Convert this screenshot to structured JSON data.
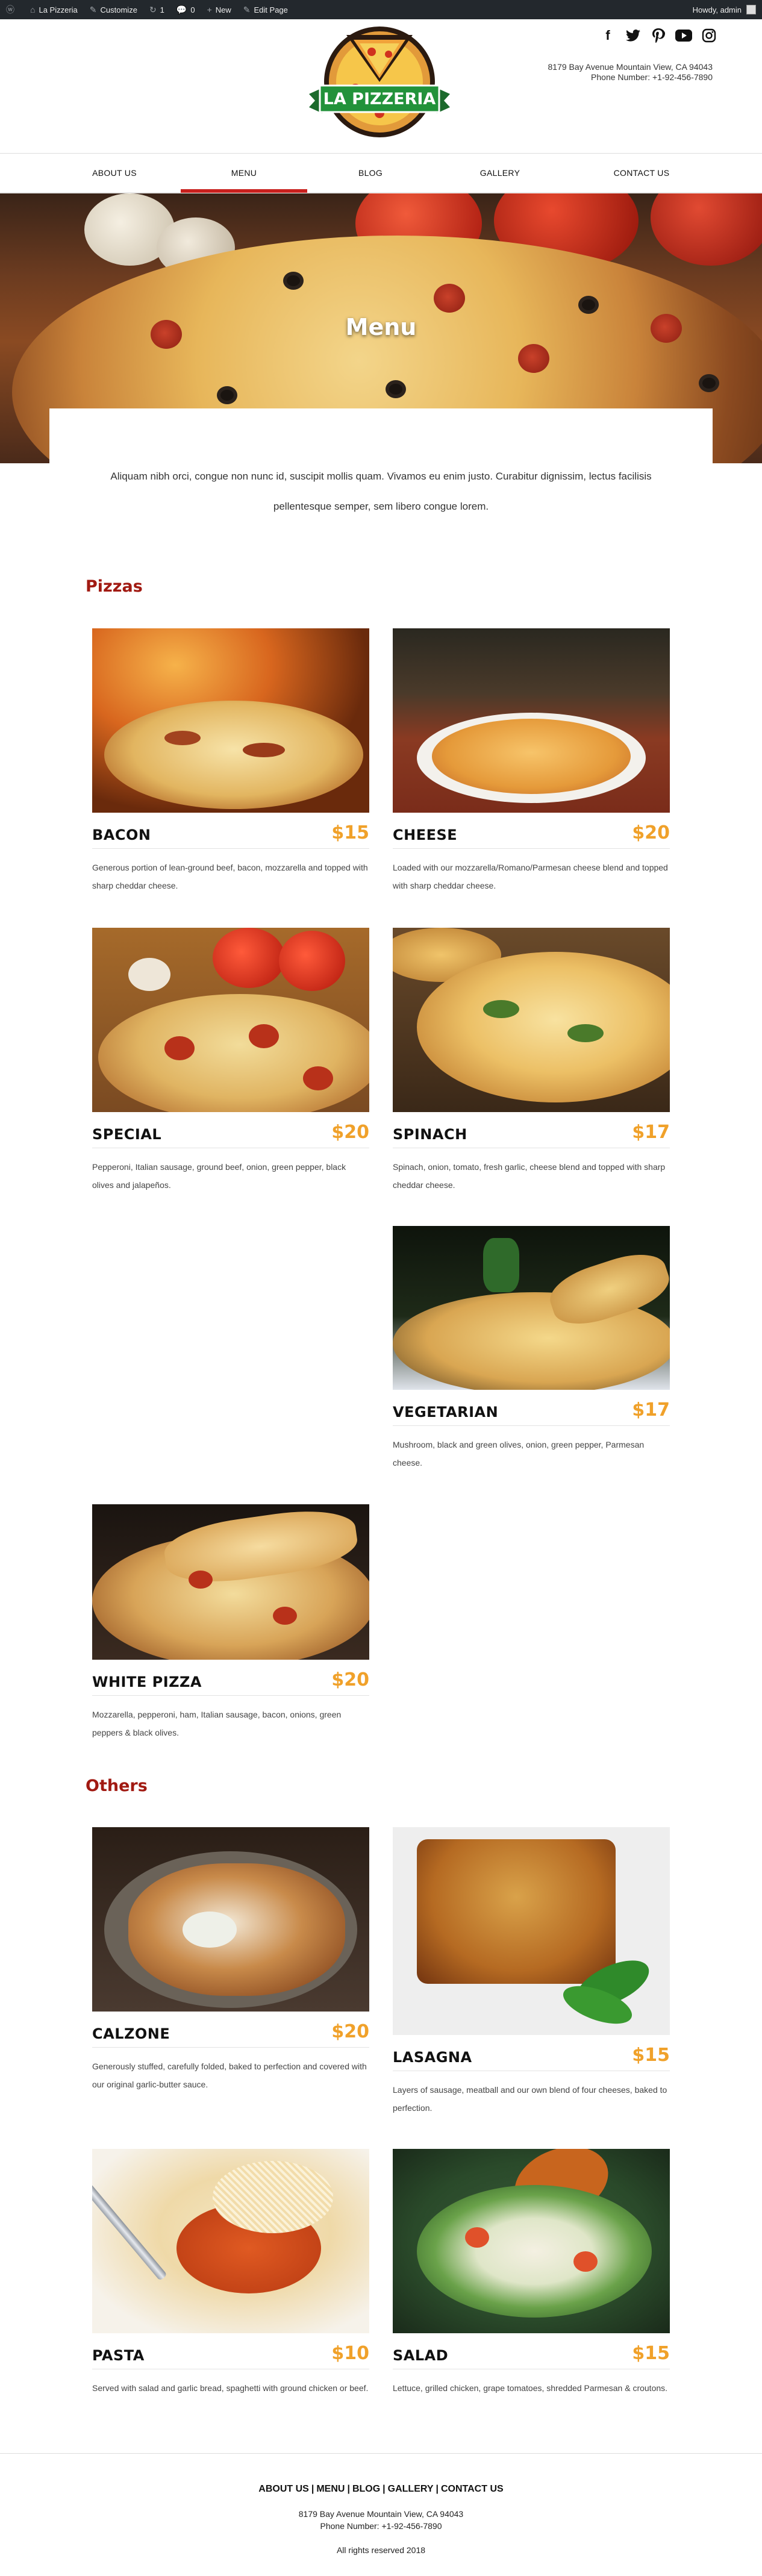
{
  "adminbar": {
    "site": "La Pizzeria",
    "customize": "Customize",
    "updates": "1",
    "comments": "0",
    "new": "New",
    "edit": "Edit Page",
    "howdy": "Howdy, admin"
  },
  "header": {
    "logo_text": "LA PIZZERIA",
    "address": "8179 Bay Avenue Mountain View, CA 94043",
    "phone": "Phone Number: +1-92-456-7890",
    "social": [
      "facebook-icon",
      "twitter-icon",
      "pinterest-icon",
      "youtube-icon",
      "instagram-icon"
    ]
  },
  "nav": {
    "items": [
      "ABOUT US",
      "MENU",
      "BLOG",
      "GALLERY",
      "CONTACT US"
    ],
    "active": "MENU"
  },
  "hero": {
    "title": "Menu"
  },
  "intro": "Aliquam nibh orci, congue non nunc id, suscipit mollis quam. Vivamos eu enim justo. Curabitur dignissim, lectus facilisis pellentesque semper, sem libero congue lorem.",
  "sections": {
    "pizzas": "Pizzas",
    "others": "Others"
  },
  "pizzas": [
    {
      "name": "BACON",
      "price": "$15",
      "desc": "Generous portion of lean-ground beef, bacon, mozzarella and topped with sharp cheddar cheese."
    },
    {
      "name": "CHEESE",
      "price": "$20",
      "desc": "Loaded with our mozzarella/Romano/Parmesan cheese blend and topped with sharp cheddar cheese."
    },
    {
      "name": "SPECIAL",
      "price": "$20",
      "desc": "Pepperoni, Italian sausage, ground beef, onion, green pepper, black olives and jalapeños."
    },
    {
      "name": "SPINACH",
      "price": "$17",
      "desc": "Spinach, onion, tomato, fresh garlic, cheese blend and topped with sharp cheddar cheese."
    },
    {
      "name": "VEGETARIAN",
      "price": "$17",
      "desc": "Mushroom, black and green olives, onion, green pepper, Parmesan cheese."
    },
    {
      "name": "WHITE PIZZA",
      "price": "$20",
      "desc": "Mozzarella, pepperoni, ham, Italian sausage, bacon, onions, green peppers & black olives."
    }
  ],
  "others": [
    {
      "name": "CALZONE",
      "price": "$20",
      "desc": "Generously stuffed, carefully folded, baked to perfection and covered with our original garlic-butter sauce."
    },
    {
      "name": "LASAGNA",
      "price": "$15",
      "desc": "Layers of sausage, meatball and our own blend of four cheeses, baked to perfection."
    },
    {
      "name": "PASTA",
      "price": "$10",
      "desc": "Served with salad and garlic bread, spaghetti with ground chicken or beef."
    },
    {
      "name": "SALAD",
      "price": "$15",
      "desc": "Lettuce, grilled chicken, grape tomatoes, shredded Parmesan & croutons."
    }
  ],
  "footer": {
    "links": [
      "ABOUT US",
      "MENU",
      "BLOG",
      "GALLERY",
      "CONTACT US"
    ],
    "address": "8179 Bay Avenue Mountain View, CA 94043",
    "phone": "Phone Number: +1-92-456-7890",
    "rights": "All rights reserved 2018"
  }
}
